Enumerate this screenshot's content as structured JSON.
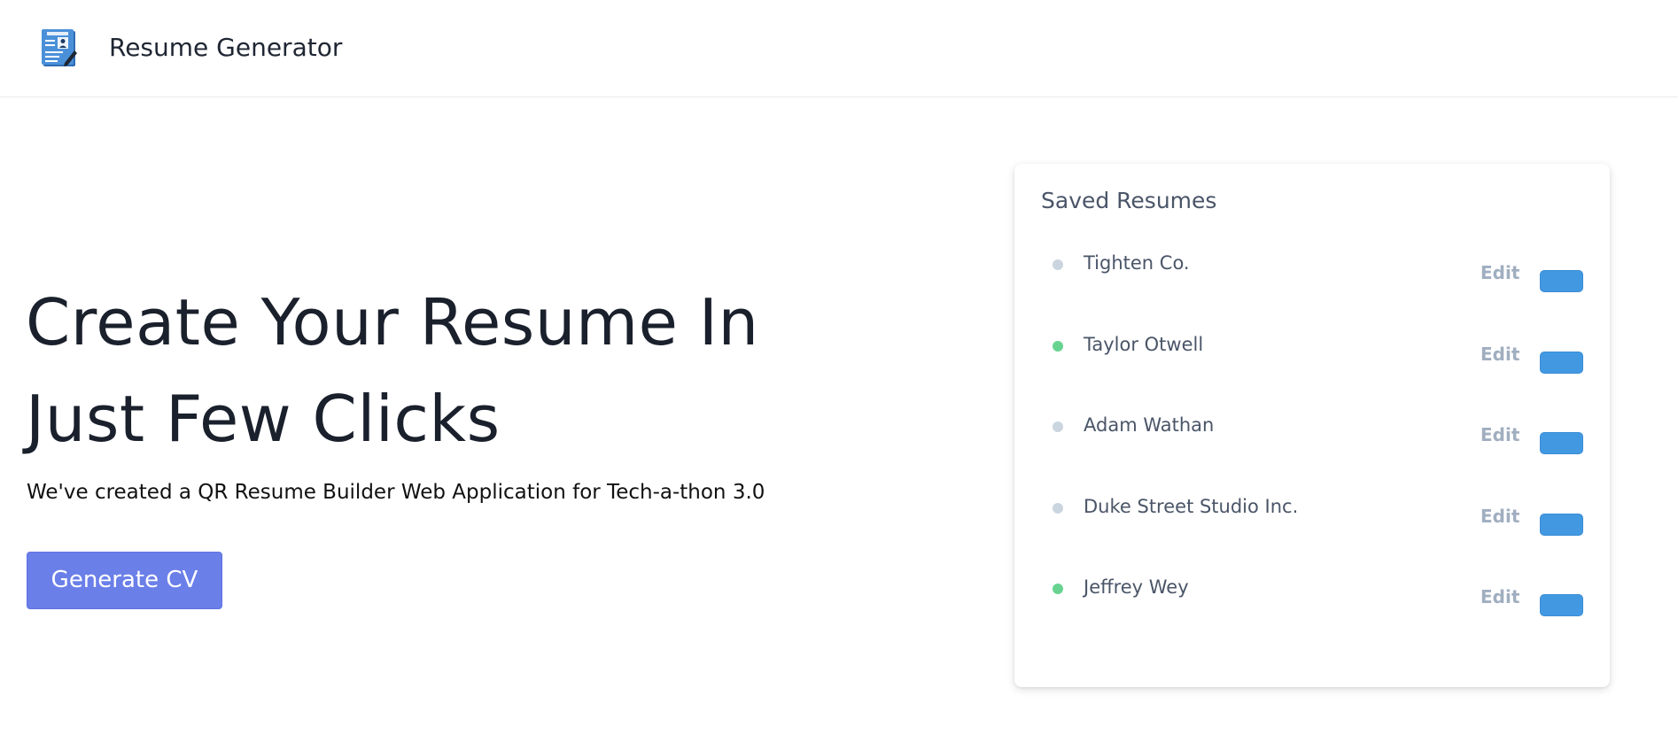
{
  "header": {
    "brand": "Resume Generator",
    "logo_icon": "resume-document-icon"
  },
  "hero": {
    "title_line_1": "Create Your Resume In",
    "title_line_2": "Just Few Clicks",
    "subtitle": "We've created a QR Resume Builder Web Application for Tech-a-thon 3.0",
    "cta_label": "Generate CV"
  },
  "saved_resumes": {
    "title": "Saved Resumes",
    "edit_label": "Edit",
    "items": [
      {
        "name": "Tighten Co.",
        "status_color": "#cbd5e0"
      },
      {
        "name": "Taylor Otwell",
        "status_color": "#68d391"
      },
      {
        "name": "Adam Wathan",
        "status_color": "#cbd5e0"
      },
      {
        "name": "Duke Street Studio Inc.",
        "status_color": "#cbd5e0"
      },
      {
        "name": "Jeffrey Wey",
        "status_color": "#68d391"
      }
    ]
  },
  "colors": {
    "primary": "#6b7fe9",
    "accent_blue": "#4299e1",
    "muted": "#a0aec0"
  }
}
